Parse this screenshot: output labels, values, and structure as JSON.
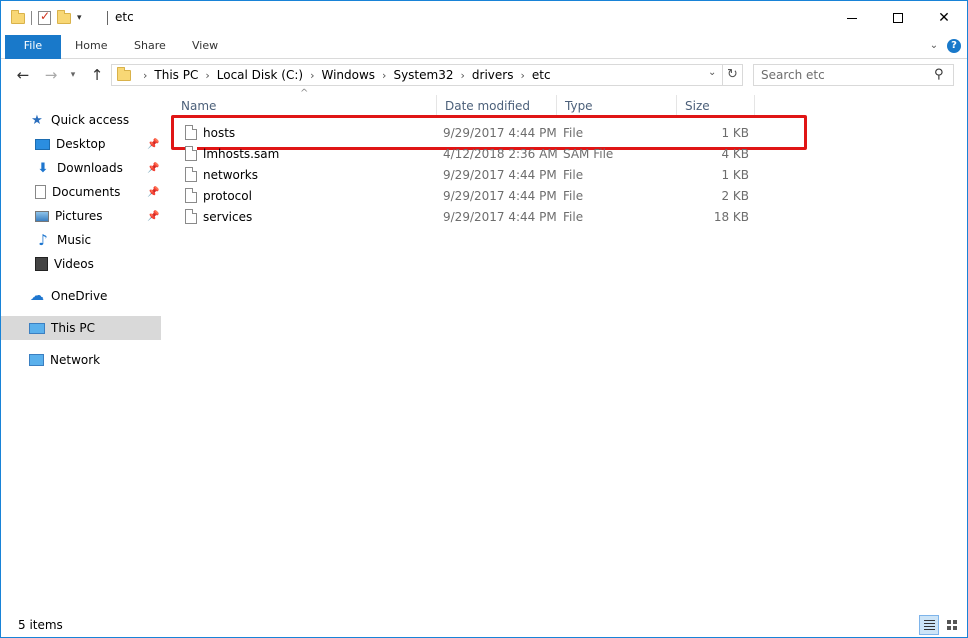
{
  "window": {
    "title": "etc",
    "accent_color": "#1979ca",
    "highlight_color": "#e01515"
  },
  "ribbon": {
    "tabs": [
      "File",
      "Home",
      "Share",
      "View"
    ]
  },
  "address": {
    "crumbs": [
      "This PC",
      "Local Disk (C:)",
      "Windows",
      "System32",
      "drivers",
      "etc"
    ],
    "search_placeholder": "Search etc"
  },
  "sidebar": {
    "quick_access": "Quick access",
    "pinned": [
      {
        "label": "Desktop",
        "icon": "desktop-icon"
      },
      {
        "label": "Downloads",
        "icon": "download-icon"
      },
      {
        "label": "Documents",
        "icon": "document-icon"
      },
      {
        "label": "Pictures",
        "icon": "pictures-icon"
      }
    ],
    "libraries": [
      {
        "label": "Music",
        "icon": "music-icon"
      },
      {
        "label": "Videos",
        "icon": "video-icon"
      }
    ],
    "onedrive": "OneDrive",
    "this_pc": "This PC",
    "network": "Network"
  },
  "columns": {
    "name": "Name",
    "date": "Date modified",
    "type": "Type",
    "size": "Size"
  },
  "files": [
    {
      "name": "hosts",
      "date": "9/29/2017 4:44 PM",
      "type": "File",
      "size": "1 KB",
      "highlighted": true
    },
    {
      "name": "lmhosts.sam",
      "date": "4/12/2018 2:36 AM",
      "type": "SAM File",
      "size": "4 KB"
    },
    {
      "name": "networks",
      "date": "9/29/2017 4:44 PM",
      "type": "File",
      "size": "1 KB"
    },
    {
      "name": "protocol",
      "date": "9/29/2017 4:44 PM",
      "type": "File",
      "size": "2 KB"
    },
    {
      "name": "services",
      "date": "9/29/2017 4:44 PM",
      "type": "File",
      "size": "18 KB"
    }
  ],
  "status": {
    "item_count": "5 items"
  }
}
